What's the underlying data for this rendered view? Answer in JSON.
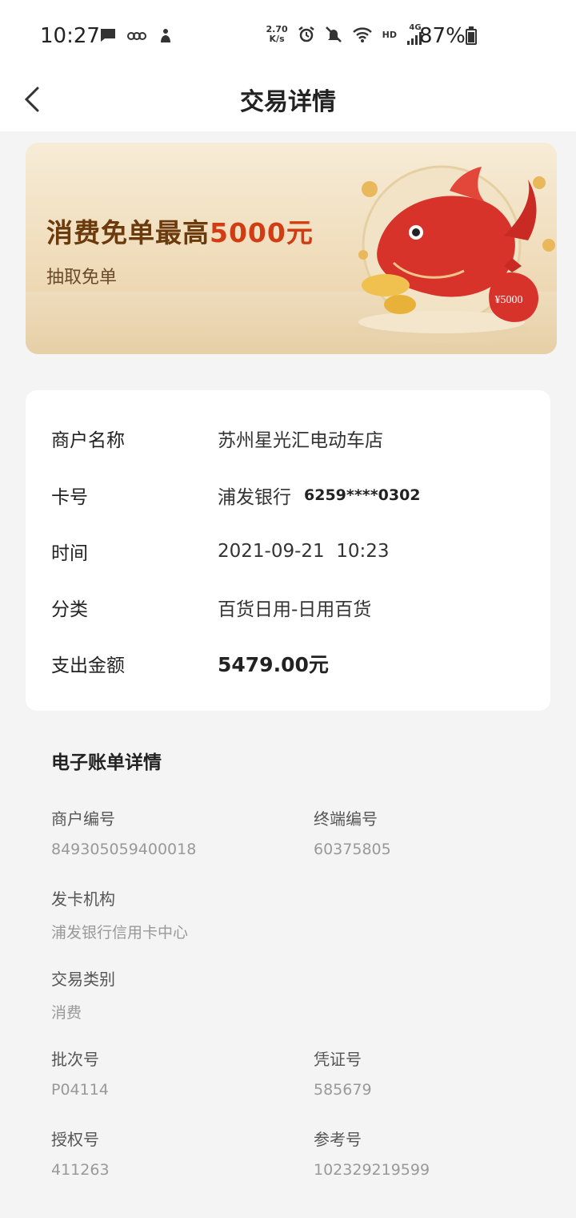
{
  "status_bar": {
    "time": "10:27",
    "net_speed_value": "2.70",
    "net_speed_unit": "K/s",
    "hd": "HD",
    "net": "4G",
    "battery": "87%",
    "icons": [
      "message-icon",
      "app-icon",
      "app-icon",
      "alarm-icon",
      "mute-icon",
      "wifi-icon",
      "signal-icon",
      "battery-icon"
    ]
  },
  "nav": {
    "title": "交易详情"
  },
  "banner": {
    "title_prefix": "消费免单最高",
    "title_highlight": "5000元",
    "subtitle": "抽取免单",
    "bag_label": "¥5000"
  },
  "details": {
    "merchant_label": "商户名称",
    "merchant_value": "苏州星光汇电动车店",
    "card_label": "卡号",
    "card_bank": "浦发银行",
    "card_number": "6259****0302",
    "time_label": "时间",
    "time_value": "2021-09-21  10:23",
    "category_label": "分类",
    "category_value": "百货日用-日用百货",
    "amount_label": "支出金额",
    "amount_value": "5479.00元"
  },
  "ebill": {
    "title": "电子账单详情",
    "merchant_no_label": "商户编号",
    "merchant_no_value": "849305059400018",
    "terminal_no_label": "终端编号",
    "terminal_no_value": "60375805",
    "issuer_label": "发卡机构",
    "issuer_value": "浦发银行信用卡中心",
    "txn_type_label": "交易类别",
    "txn_type_value": "消费",
    "batch_no_label": "批次号",
    "batch_no_value": "P04114",
    "voucher_no_label": "凭证号",
    "voucher_no_value": "585679",
    "auth_no_label": "授权号",
    "auth_no_value": "411263",
    "ref_no_label": "参考号",
    "ref_no_value": "102329219599"
  },
  "colors": {
    "page_bg": "#f4f4f4",
    "banner_highlight": "#d23c13",
    "banner_title": "#6b3a0d",
    "secondary_text": "#999999"
  }
}
